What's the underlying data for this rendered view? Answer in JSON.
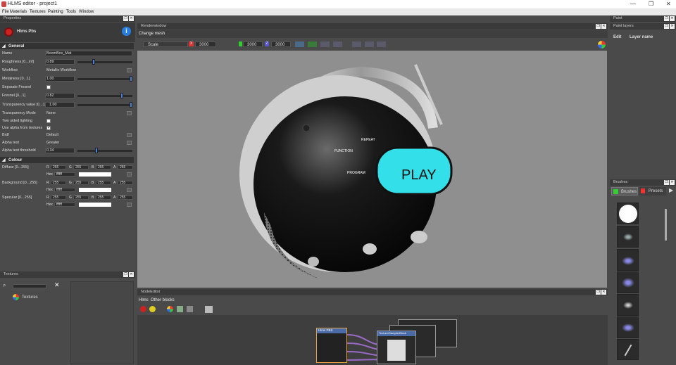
{
  "window": {
    "title": "HLMS editor - project1"
  },
  "menu": [
    "File",
    "Materials",
    "Textures",
    "Painting",
    "Tools",
    "Window"
  ],
  "properties": {
    "title": "Properties",
    "header": "Hlms Pbs",
    "general_label": "General",
    "rows": [
      {
        "label": "Name",
        "value": "BoomBox_Mat"
      },
      {
        "label": "Roughness [0...inf]",
        "value": "0.89"
      },
      {
        "label": "Workflow",
        "value": "Metallic Workflow"
      },
      {
        "label": "Metalness [0...1]",
        "value": "1.00"
      },
      {
        "label": "Separate Fresnel",
        "value": ""
      },
      {
        "label": "Fresnel [0...1]",
        "value": "0.82"
      },
      {
        "label": "Transparency value [0...1]",
        "value": "1.00"
      },
      {
        "label": "Transparency Mode",
        "value": "None"
      },
      {
        "label": "Two sided lighting",
        "value": ""
      },
      {
        "label": "Use alpha from textures",
        "value": ""
      },
      {
        "label": "Brdf",
        "value": "Default"
      },
      {
        "label": "Alpha test",
        "value": "Greater"
      },
      {
        "label": "Alpha test threshold",
        "value": "0.34"
      }
    ],
    "slider_levels": {
      "roughness": 0.3,
      "metalness": 1.0,
      "fresnel": 0.82,
      "transparency": 1.0,
      "alpha_threshold": 0.34
    },
    "colour_label": "Colour",
    "colours": [
      {
        "label": "Diffuse [0...255]",
        "r": "255",
        "g": "255",
        "b": "255",
        "a": "255",
        "hex": "ffffff"
      },
      {
        "label": "Background [0...255]",
        "r": "255",
        "g": "255",
        "b": "255",
        "a": "255",
        "hex": "ffffff"
      },
      {
        "label": "Specular [0...255]",
        "r": "255",
        "g": "255",
        "b": "255",
        "a": "255",
        "hex": "ffffff"
      }
    ],
    "r": "R",
    "g": "G",
    "b": "B",
    "a": "A",
    "hex": "Hex"
  },
  "textures": {
    "title": "Textures",
    "item": "Textures"
  },
  "render": {
    "title": "Renderwindow",
    "change_mesh": "Change mesh",
    "mode": "Scale",
    "x_label": "X",
    "x_val": "3000",
    "y_val": "3000",
    "z_label": "Z",
    "z_val": "3000",
    "labels": {
      "function": "FUNCTION",
      "repeat": "REPEAT",
      "program": "PROGRAM",
      "play": "PLAY"
    }
  },
  "node_editor": {
    "title": "NodeEditor",
    "tabs": [
      "Hlms",
      "Other blocks"
    ],
    "node_title": "Hlms PBS",
    "sampler": "Texture/SamplerBlock"
  },
  "paint": {
    "title": "Paint",
    "layer_title": "Paint layers",
    "edit": "Edit",
    "layer_name": "Layer name"
  },
  "brushes": {
    "title": "Brushes",
    "tab_brushes": "Brushes",
    "tab_presets": "Presets"
  },
  "colors": {
    "accent": "#4a7dd6",
    "play_screen": "#33e0ea",
    "viewport_bg": "#8f8f8f"
  }
}
